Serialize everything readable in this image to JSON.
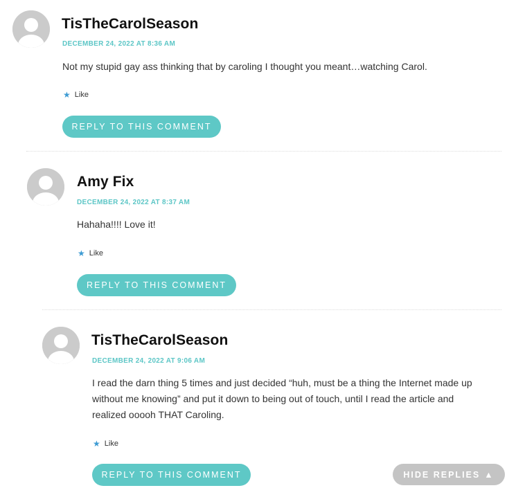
{
  "comments": [
    {
      "author": "TisTheCarolSeason",
      "date": "DECEMBER 24, 2022 AT 8:36 AM",
      "text": "Not my stupid gay ass thinking that by caroling I thought you meant…watching Carol.",
      "like_label": "Like",
      "reply_label": "REPLY TO THIS COMMENT"
    },
    {
      "author": "Amy Fix",
      "date": "DECEMBER 24, 2022 AT 8:37 AM",
      "text": "Hahaha!!!! Love it!",
      "like_label": "Like",
      "reply_label": "REPLY TO THIS COMMENT"
    },
    {
      "author": "TisTheCarolSeason",
      "date": "DECEMBER 24, 2022 AT 9:06 AM",
      "text_lines": [
        "I read the darn thing 5 times and just decided “huh, must be a thing the Internet made up",
        "without me knowing” and put it down to being out of touch, until I read the article and",
        "realized ooooh THAT Caroling."
      ],
      "like_label": "Like",
      "reply_label": "REPLY TO THIS COMMENT"
    }
  ],
  "hide_replies_label": "HIDE REPLIES",
  "hide_replies_icon": "triangle-up-icon",
  "like_icon": "star-icon",
  "colors": {
    "accent": "#5ec8c6",
    "date": "#5cc6c6",
    "star": "#3d9bd3",
    "hide_button": "#c4c4c4"
  }
}
